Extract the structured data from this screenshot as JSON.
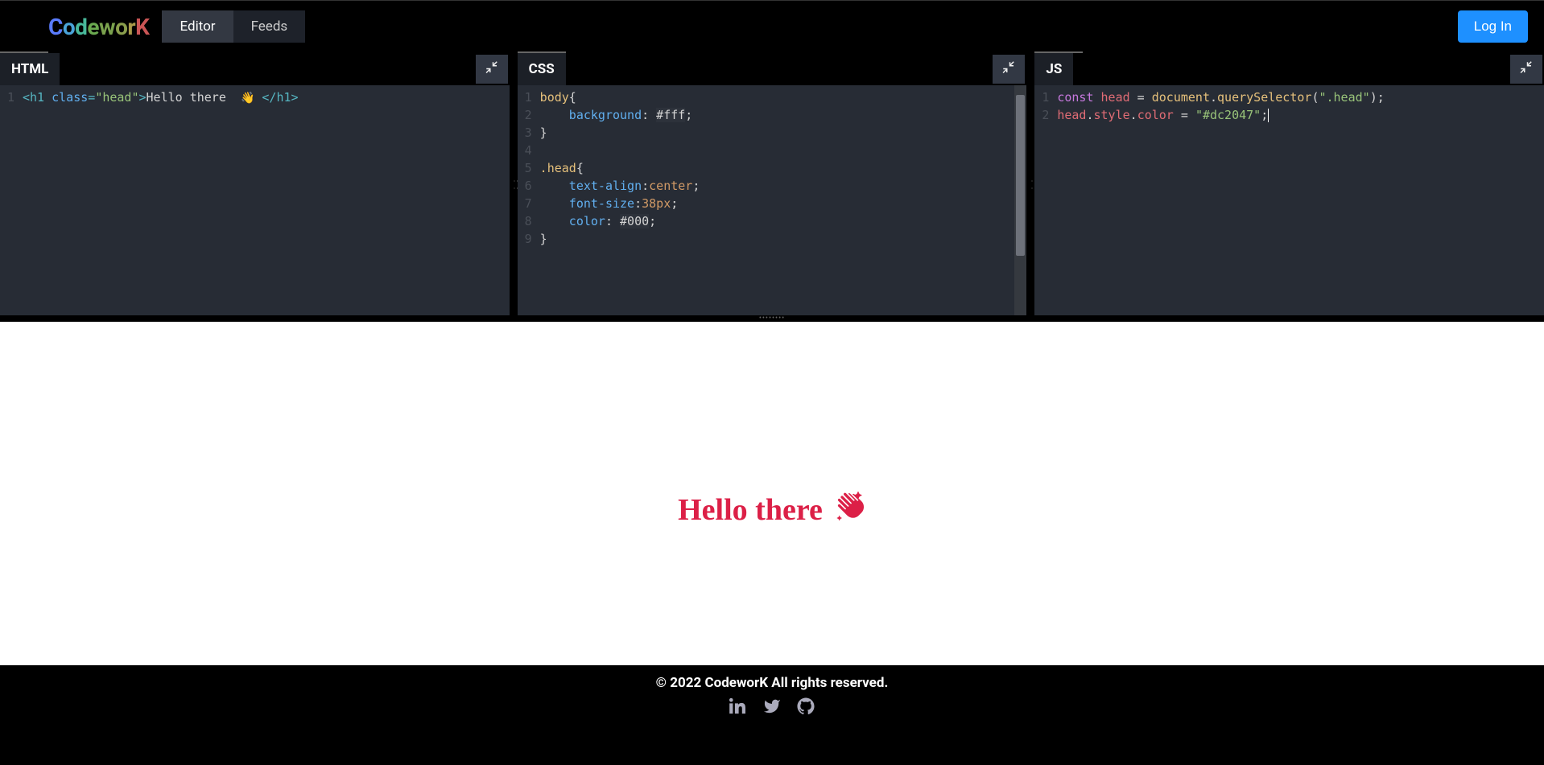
{
  "header": {
    "logo_chars": [
      "C",
      "o",
      "d",
      "e",
      "w",
      "o",
      "r",
      "K"
    ],
    "tabs": [
      {
        "label": "Editor",
        "active": true
      },
      {
        "label": "Feeds",
        "active": false
      }
    ],
    "login_label": "Log In"
  },
  "panes": {
    "html": {
      "label": "HTML",
      "lines": [
        {
          "n": 1,
          "tokens": [
            {
              "c": "tok-tag",
              "t": "<h1 "
            },
            {
              "c": "tok-attr",
              "t": "class"
            },
            {
              "c": "tok-op",
              "t": "="
            },
            {
              "c": "tok-str",
              "t": "\"head\""
            },
            {
              "c": "tok-tag",
              "t": ">"
            },
            {
              "c": "tok-text",
              "t": "Hello there  "
            },
            {
              "c": "emoji",
              "t": "👋"
            },
            {
              "c": "tok-text",
              "t": " "
            },
            {
              "c": "tok-tag",
              "t": "</h1>"
            }
          ]
        }
      ]
    },
    "css": {
      "label": "CSS",
      "lines": [
        {
          "n": 1,
          "tokens": [
            {
              "c": "tok-sel",
              "t": "body"
            },
            {
              "c": "tok-punct",
              "t": "{"
            }
          ]
        },
        {
          "n": 2,
          "tokens": [
            {
              "c": "tok-text",
              "t": "    "
            },
            {
              "c": "tok-prop",
              "t": "background"
            },
            {
              "c": "tok-punct",
              "t": ": "
            },
            {
              "c": "tok-colorhex",
              "t": "#fff"
            },
            {
              "c": "tok-punct",
              "t": ";"
            }
          ]
        },
        {
          "n": 3,
          "tokens": [
            {
              "c": "tok-punct",
              "t": "}"
            }
          ]
        },
        {
          "n": 4,
          "tokens": [
            {
              "c": "tok-text",
              "t": ""
            }
          ]
        },
        {
          "n": 5,
          "tokens": [
            {
              "c": "tok-sel",
              "t": ".head"
            },
            {
              "c": "tok-punct",
              "t": "{"
            }
          ]
        },
        {
          "n": 6,
          "tokens": [
            {
              "c": "tok-text",
              "t": "    "
            },
            {
              "c": "tok-prop",
              "t": "text-align"
            },
            {
              "c": "tok-punct",
              "t": ":"
            },
            {
              "c": "tok-val",
              "t": "center"
            },
            {
              "c": "tok-punct",
              "t": ";"
            }
          ]
        },
        {
          "n": 7,
          "tokens": [
            {
              "c": "tok-text",
              "t": "    "
            },
            {
              "c": "tok-prop",
              "t": "font-size"
            },
            {
              "c": "tok-punct",
              "t": ":"
            },
            {
              "c": "tok-val",
              "t": "38px"
            },
            {
              "c": "tok-punct",
              "t": ";"
            }
          ]
        },
        {
          "n": 8,
          "tokens": [
            {
              "c": "tok-text",
              "t": "    "
            },
            {
              "c": "tok-prop",
              "t": "color"
            },
            {
              "c": "tok-punct",
              "t": ": "
            },
            {
              "c": "tok-colorhex",
              "t": "#000"
            },
            {
              "c": "tok-punct",
              "t": ";"
            }
          ]
        },
        {
          "n": 9,
          "tokens": [
            {
              "c": "tok-punct",
              "t": "}"
            }
          ]
        }
      ]
    },
    "js": {
      "label": "JS",
      "lines": [
        {
          "n": 1,
          "tokens": [
            {
              "c": "tok-kw",
              "t": "const "
            },
            {
              "c": "tok-ident",
              "t": "head"
            },
            {
              "c": "tok-punct",
              "t": " = "
            },
            {
              "c": "tok-func",
              "t": "document"
            },
            {
              "c": "tok-dot",
              "t": "."
            },
            {
              "c": "tok-func",
              "t": "querySelector"
            },
            {
              "c": "tok-punct",
              "t": "("
            },
            {
              "c": "tok-str",
              "t": "\".head\""
            },
            {
              "c": "tok-punct",
              "t": ");"
            }
          ]
        },
        {
          "n": 2,
          "tokens": [
            {
              "c": "tok-ident",
              "t": "head"
            },
            {
              "c": "tok-dot",
              "t": "."
            },
            {
              "c": "tok-ident",
              "t": "style"
            },
            {
              "c": "tok-dot",
              "t": "."
            },
            {
              "c": "tok-ident",
              "t": "color"
            },
            {
              "c": "tok-punct",
              "t": " = "
            },
            {
              "c": "tok-str",
              "t": "\"#dc2047\""
            },
            {
              "c": "tok-punct",
              "t": ";"
            }
          ],
          "cursor": true
        }
      ]
    }
  },
  "preview": {
    "heading_text": "Hello there",
    "heading_color": "#dc2047"
  },
  "footer": {
    "copyright": "© 2022 CodeworK All rights reserved.",
    "social": [
      "linkedin",
      "twitter",
      "github"
    ]
  }
}
